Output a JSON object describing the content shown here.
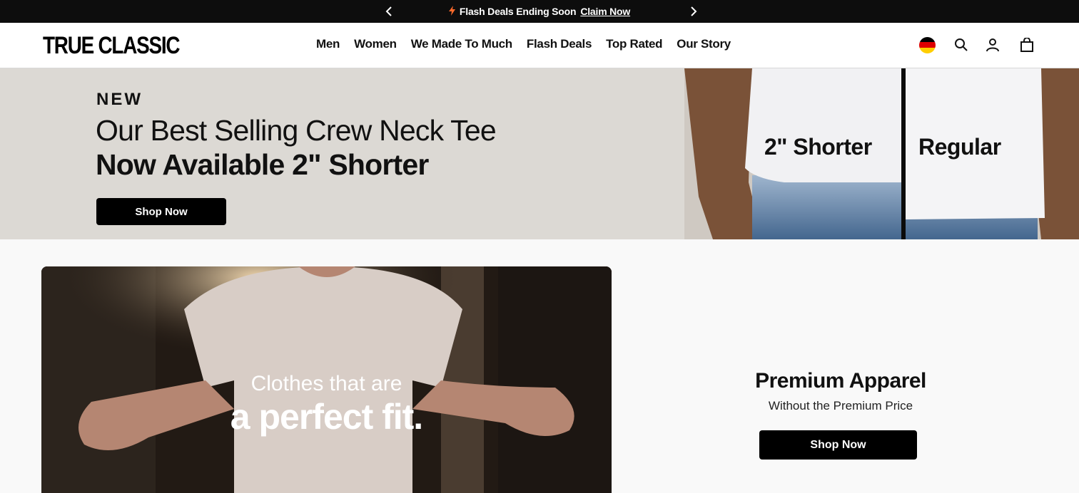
{
  "announcement": {
    "text": "Flash Deals Ending Soon",
    "link": "Claim Now",
    "prev_icon": "chevron-left-icon",
    "next_icon": "chevron-right-icon",
    "bolt_icon": "lightning-icon",
    "bolt_color": "#ff6a2b"
  },
  "header": {
    "logo": "TRUE CLASSIC",
    "nav": [
      "Men",
      "Women",
      "We Made To Much",
      "Flash Deals",
      "Top Rated",
      "Our Story"
    ],
    "icons": [
      "germany-flag-icon",
      "search-icon",
      "account-icon",
      "cart-icon"
    ]
  },
  "hero": {
    "eyebrow": "NEW",
    "line1": "Our Best Selling Crew Neck Tee",
    "line2": "Now Available 2\" Shorter",
    "cta": "Shop Now",
    "label_left": "2\" Shorter",
    "label_right": "Regular"
  },
  "feature": {
    "video_caption_1": "Clothes that are",
    "video_caption_2": "a perfect fit.",
    "title": "Premium Apparel",
    "subtitle": "Without the Premium Price",
    "cta": "Shop Now"
  },
  "colors": {
    "brand_black": "#000000",
    "hero_bg": "#dcd9d4",
    "page_bg": "#f9f9f9"
  }
}
